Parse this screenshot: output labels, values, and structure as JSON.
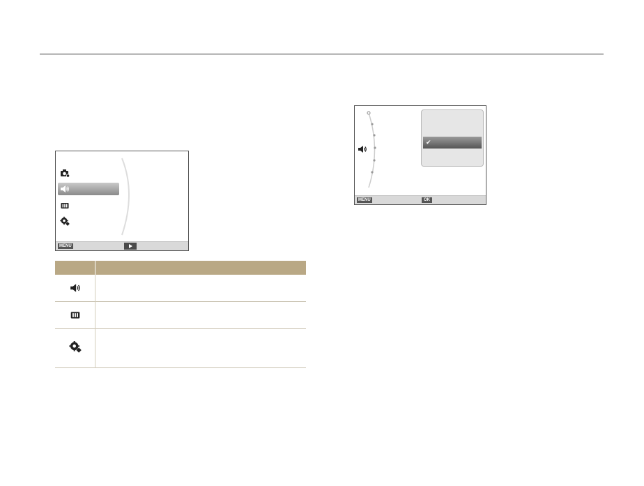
{
  "header": {
    "title": ""
  },
  "screen1": {
    "menu_key": "MENU",
    "menu_items": [
      {
        "icon": "camera-settings-icon"
      },
      {
        "icon": "sound-icon",
        "selected": true
      },
      {
        "icon": "display-icon"
      },
      {
        "icon": "settings-icon"
      }
    ]
  },
  "screen2": {
    "menu_key": "MENU",
    "ok_key": "OK",
    "dropdown_selected_mark": "✔"
  },
  "table": {
    "header_color": "#b9a885",
    "rows": [
      {
        "icon": "sound-icon"
      },
      {
        "icon": "display-icon"
      },
      {
        "icon": "settings-icon"
      }
    ]
  }
}
